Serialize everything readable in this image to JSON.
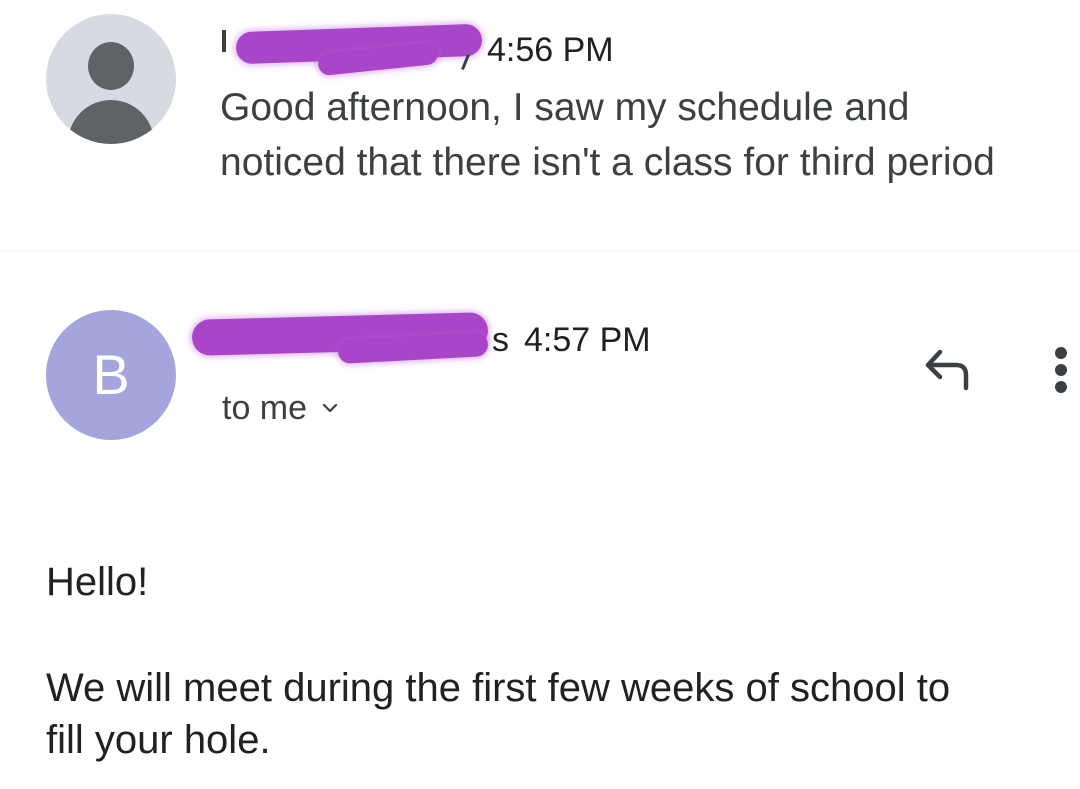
{
  "messages": [
    {
      "time": "4:56 PM",
      "snippet_line1": "Good afternoon, I saw my schedule and",
      "snippet_line2": "noticed that there isn't a class for third period"
    },
    {
      "avatar_letter": "B",
      "sender_suffix": "s",
      "time": "4:57 PM",
      "recipient": "to me",
      "greeting": "Hello!",
      "body_line1": "We will meet during the first few weeks of school to",
      "body_line2": "fill your hole."
    }
  ],
  "icons": {
    "first_avatar": "person-icon",
    "reply": "reply-icon",
    "more": "more-vert-icon",
    "expand": "chevron-down-icon"
  },
  "colors": {
    "redaction": "#a945c8",
    "avatar_b": "#a5a5dd",
    "avatar_generic_bg": "#d7dbe1",
    "text": "#202124"
  }
}
